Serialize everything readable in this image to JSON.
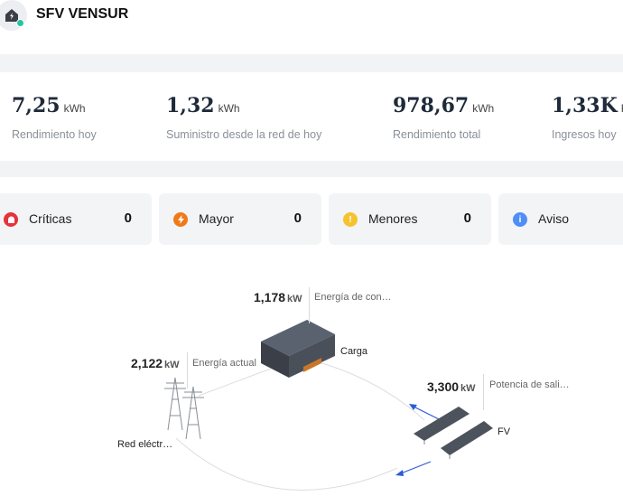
{
  "header": {
    "title": "SFV VENSUR"
  },
  "stats": [
    {
      "value": "7,25",
      "unit": "kWh",
      "label": "Rendimiento hoy"
    },
    {
      "value": "1,32",
      "unit": "kWh",
      "label": "Suministro desde la red de hoy"
    },
    {
      "value": "978,67",
      "unit": "kWh",
      "label": "Rendimiento total"
    },
    {
      "value": "1,33K",
      "unit": "P.",
      "label": "Ingresos hoy"
    }
  ],
  "alarms": [
    {
      "label": "Críticas",
      "count": "0",
      "color": "#e5323b",
      "icon": "critical-alarm-icon"
    },
    {
      "label": "Mayor",
      "count": "0",
      "color": "#f07a1a",
      "icon": "major-alarm-icon"
    },
    {
      "label": "Menores",
      "count": "0",
      "color": "#f5c330",
      "icon": "minor-alarm-icon"
    },
    {
      "label": "Aviso",
      "count": "",
      "color": "#4f8ef7",
      "icon": "warning-alarm-icon"
    }
  ],
  "flow": {
    "load": {
      "value": "1,178",
      "unit": "kW",
      "label": "Energía de con…",
      "name": "Carga"
    },
    "grid": {
      "value": "2,122",
      "unit": "kW",
      "label": "Energía actual",
      "name": "Red eléctr…"
    },
    "pv": {
      "value": "3,300",
      "unit": "kW",
      "label": "Potencia de sali…",
      "name": "FV"
    }
  }
}
